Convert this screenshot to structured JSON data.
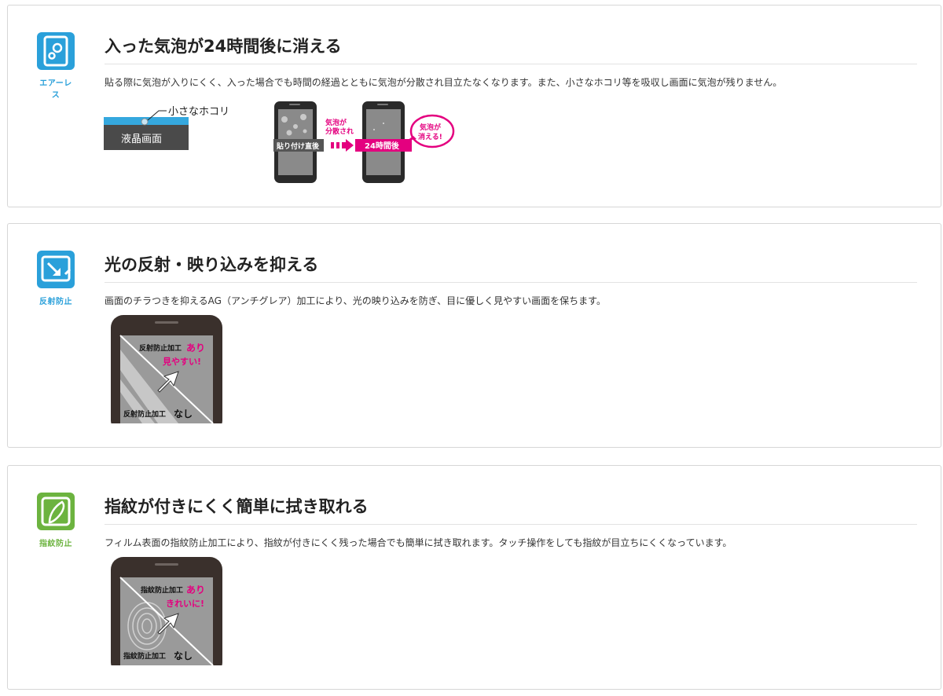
{
  "sections": [
    {
      "badge_label": "エアーレス",
      "badge_color": "#2aa0da",
      "icon": "bubble-icon",
      "title": "入った気泡が24時間後に消える",
      "description": "貼る際に気泡が入りにくく、入った場合でも時間の経過とともに気泡が分散され目立たなくなります。また、小さなホコリ等を吸収し画面に気泡が残りません。",
      "illustration": {
        "dust_label": "小さなホコリ",
        "lcd_label": "液晶画面",
        "bubbles_dispersed": "気泡が\n分散され",
        "right_after_label": "貼り付け直後",
        "after_24h_label": "24時間後",
        "bubbles_gone": "気泡が\n消える!"
      }
    },
    {
      "badge_label": "反射防止",
      "badge_color": "#2aa0da",
      "icon": "reflection-icon",
      "title": "光の反射・映り込みを抑える",
      "description": "画面のチラつきを抑えるAG（アンチグレア）加工により、光の映り込みを防ぎ、目に優しく見やすい画面を保ちます。",
      "illustration": {
        "with_label": "反射防止加工",
        "with_suffix": "あり",
        "benefit": "見やすい!",
        "without_label": "反射防止加工",
        "without_suffix": "なし"
      }
    },
    {
      "badge_label": "指紋防止",
      "badge_color": "#6cb33f",
      "icon": "finger-icon",
      "title": "指紋が付きにくく簡単に拭き取れる",
      "description": "フィルム表面の指紋防止加工により、指紋が付きにくく残った場合でも簡単に拭き取れます。タッチ操作をしても指紋が目立ちにくくなっています。",
      "illustration": {
        "with_label": "指紋防止加工",
        "with_suffix": "あり",
        "benefit": "きれいに!",
        "without_label": "指紋防止加工",
        "without_suffix": "なし"
      }
    }
  ],
  "colors": {
    "accent_pink": "#e4007f",
    "accent_blue": "#2aa0da",
    "accent_green": "#6cb33f"
  }
}
